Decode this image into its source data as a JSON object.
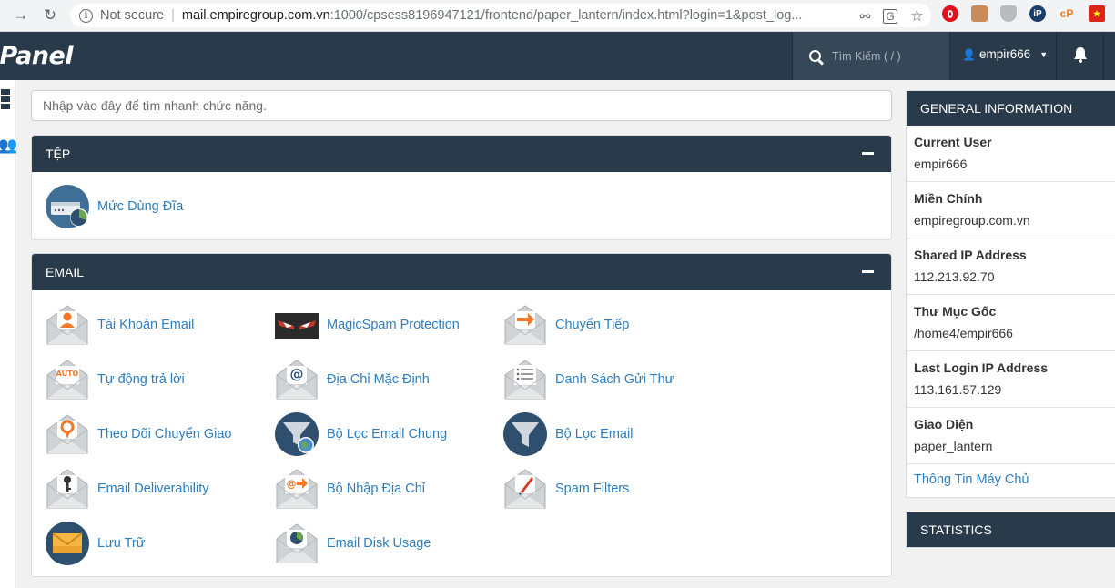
{
  "browser": {
    "security_label": "Not secure",
    "url_host": "mail.empiregroup.com.vn",
    "url_rest": ":1000/cpsess8196947121/frontend/paper_lantern/index.html?login=1&post_log..."
  },
  "header": {
    "logo": "cPanel",
    "search_placeholder": "Tìm Kiếm ( / )",
    "username": "empir666"
  },
  "quick_search": {
    "placeholder": "Nhập vào đây để tìm nhanh chức năng."
  },
  "files_panel": {
    "title": "TỆP",
    "items": [
      {
        "label": "Mức Dùng Đĩa",
        "icon": "disk-usage-icon"
      }
    ]
  },
  "email_panel": {
    "title": "EMAIL",
    "items": [
      {
        "label": "Tài Khoản Email",
        "icon": "email-account-icon"
      },
      {
        "label": "MagicSpam Protection",
        "icon": "magicspam-icon"
      },
      {
        "label": "Chuyển Tiếp",
        "icon": "forwarders-icon"
      },
      {
        "label": "Tự động trả lời",
        "icon": "autoresponder-icon",
        "badge": "AUTO"
      },
      {
        "label": "Địa Chỉ Mặc Định",
        "icon": "default-address-icon"
      },
      {
        "label": "Danh Sách Gửi Thư",
        "icon": "mailing-list-icon"
      },
      {
        "label": "Theo Dõi Chuyển Giao",
        "icon": "track-delivery-icon"
      },
      {
        "label": "Bộ Lọc Email Chung",
        "icon": "global-filter-icon"
      },
      {
        "label": "Bộ Lọc Email",
        "icon": "email-filter-icon"
      },
      {
        "label": "Email Deliverability",
        "icon": "deliverability-icon"
      },
      {
        "label": "Bộ Nhập Địa Chỉ",
        "icon": "address-importer-icon"
      },
      {
        "label": "Spam Filters",
        "icon": "spam-filters-icon"
      },
      {
        "label": "Lưu Trữ",
        "icon": "archive-icon"
      },
      {
        "label": "Email Disk Usage",
        "icon": "email-disk-usage-icon"
      }
    ]
  },
  "general_info": {
    "title": "GENERAL INFORMATION",
    "rows": [
      {
        "key": "Current User",
        "value": "empir666"
      },
      {
        "key": "Miền Chính",
        "value": "empiregroup.com.vn"
      },
      {
        "key": "Shared IP Address",
        "value": "112.213.92.70"
      },
      {
        "key": "Thư Mục Gốc",
        "value": "/home4/empir666"
      },
      {
        "key": "Last Login IP Address",
        "value": "113.161.57.129"
      },
      {
        "key": "Giao Diện",
        "value": "paper_lantern"
      }
    ],
    "link": "Thông Tin Máy Chủ"
  },
  "statistics": {
    "title": "STATISTICS"
  }
}
